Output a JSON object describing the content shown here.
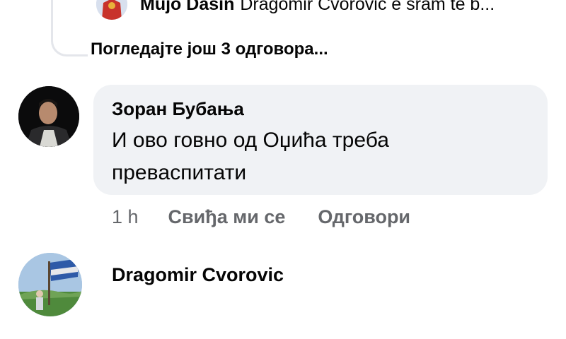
{
  "top_reply": {
    "name": "Mujo Dasin",
    "snippet": "Dragomir Cvorovic e sram te b..."
  },
  "view_more_label": "Погледајте још 3 одговора...",
  "comment": {
    "author": "Зоран Бубања",
    "text_line1": "И ово говно од Оџића треба",
    "text_line2": "превaспитати",
    "time": "1 h",
    "like_label": "Свиђа ми се",
    "reply_label": "Одговори"
  },
  "next_comment": {
    "author": "Dragomir Cvorovic"
  },
  "colors": {
    "bubble_bg": "#f0f2f5",
    "meta_text": "#65676b",
    "thread_line": "#e4e6eb"
  }
}
